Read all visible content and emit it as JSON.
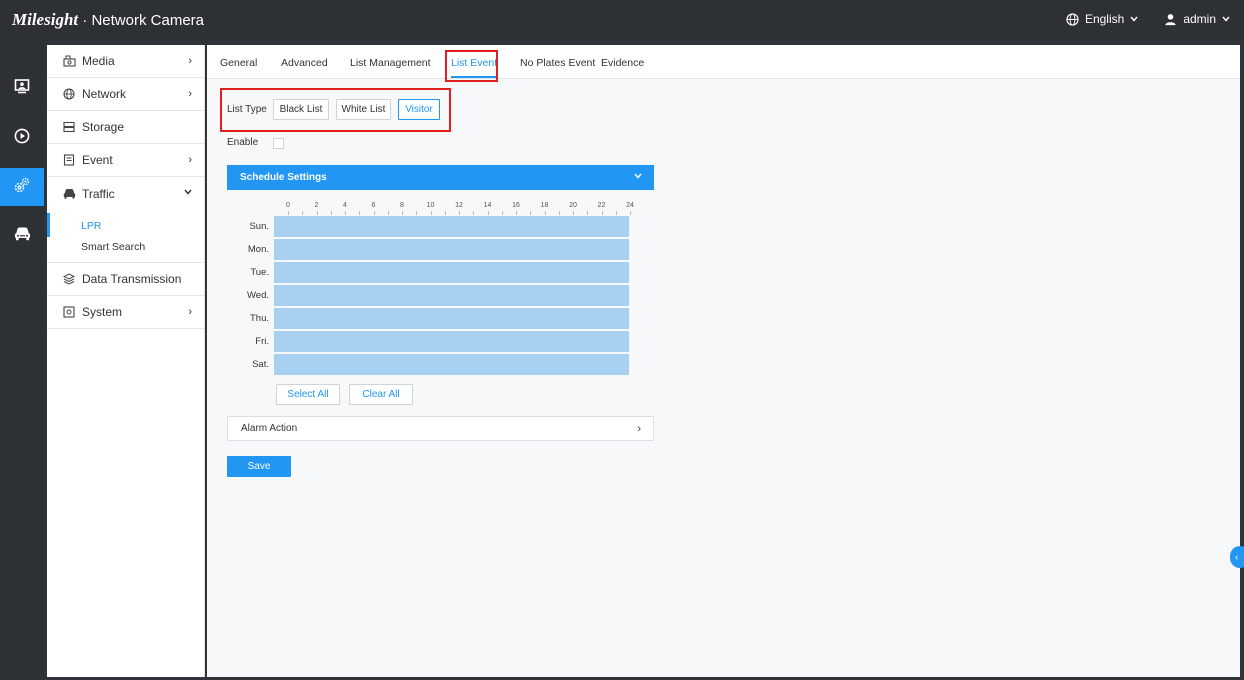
{
  "app": {
    "brand": "Milesight",
    "title": "Network Camera"
  },
  "header": {
    "language": "English",
    "user": "admin"
  },
  "rail": [
    {
      "icon": "live-view-icon"
    },
    {
      "icon": "playback-icon"
    },
    {
      "icon": "settings-icon",
      "active": true
    },
    {
      "icon": "traffic-car-icon"
    }
  ],
  "sidebar": {
    "media": "Media",
    "network": "Network",
    "storage": "Storage",
    "event": "Event",
    "traffic": "Traffic",
    "traffic_sub": {
      "lpr": "LPR",
      "smart_search": "Smart Search"
    },
    "data_transmission": "Data Transmission",
    "system": "System"
  },
  "tabs": {
    "general": "General",
    "advanced": "Advanced",
    "list_management": "List Management",
    "list_event": "List Event",
    "no_plates_event": "No Plates Event",
    "evidence": "Evidence"
  },
  "list_type": {
    "label": "List Type",
    "black": "Black List",
    "white": "White List",
    "visitor": "Visitor",
    "selected": "Visitor"
  },
  "enable": {
    "label": "Enable",
    "checked": false
  },
  "schedule": {
    "title": "Schedule Settings",
    "hours": [
      "0",
      "2",
      "4",
      "6",
      "8",
      "10",
      "12",
      "14",
      "16",
      "18",
      "20",
      "22",
      "24"
    ],
    "days": [
      "Sun.",
      "Mon.",
      "Tue.",
      "Wed.",
      "Thu.",
      "Fri.",
      "Sat."
    ],
    "select_all": "Select All",
    "clear_all": "Clear All"
  },
  "alarm_action": {
    "title": "Alarm Action"
  },
  "save": "Save",
  "colors": {
    "accent": "#2196f3",
    "schedule_fill": "#a8d1f1",
    "highlight": "#e02020",
    "dark": "#2d3035"
  }
}
